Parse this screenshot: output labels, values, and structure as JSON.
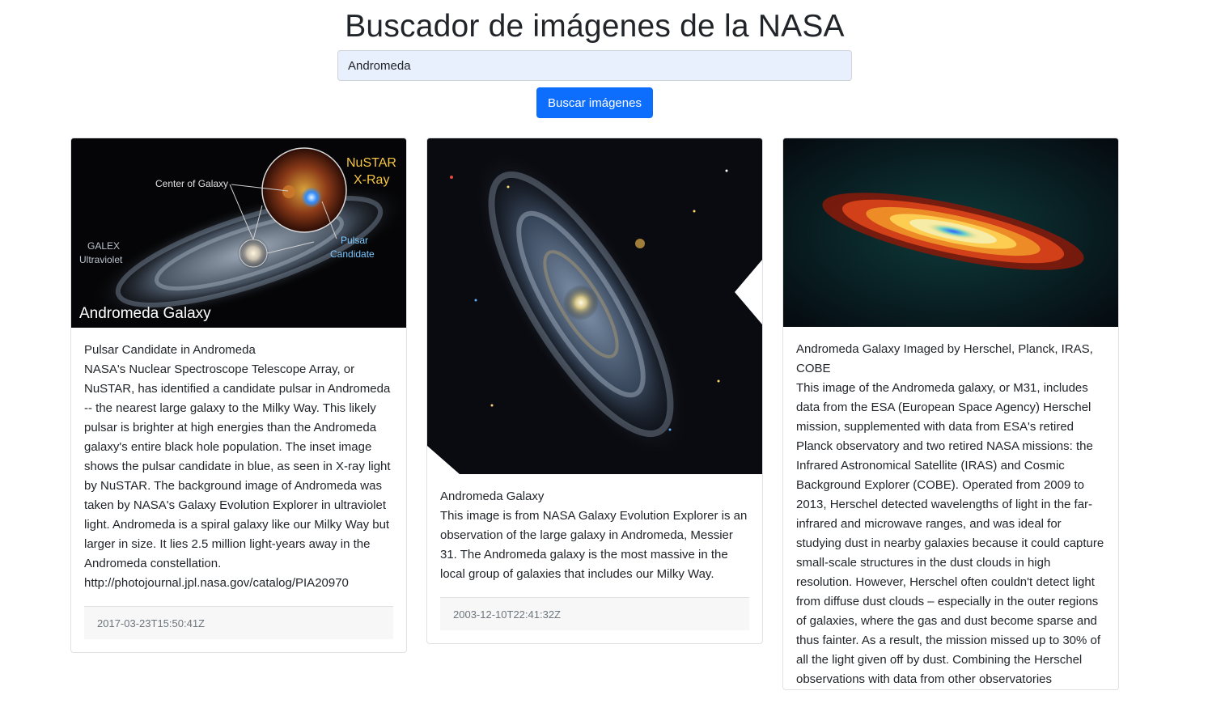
{
  "page": {
    "title": "Buscador de imágenes de la NASA"
  },
  "search": {
    "value": "Andromeda",
    "button_label": "Buscar imágenes"
  },
  "cards": [
    {
      "image_labels": {
        "main": "Andromeda Galaxy",
        "instrument_1": "NuSTAR",
        "instrument_2": "X-Ray",
        "center": "Center of Galaxy",
        "galex_1": "GALEX",
        "galex_2": "Ultraviolet",
        "pulsar_1": "Pulsar",
        "pulsar_2": "Candidate"
      },
      "title": "Pulsar Candidate in Andromeda",
      "description": "NASA's Nuclear Spectroscope Telescope Array, or NuSTAR, has identified a candidate pulsar in Andromeda -- the nearest large galaxy to the Milky Way. This likely pulsar is brighter at high energies than the Andromeda galaxy's entire black hole population. The inset image shows the pulsar candidate in blue, as seen in X-ray light by NuSTAR. The background image of Andromeda was taken by NASA's Galaxy Evolution Explorer in ultraviolet light. Andromeda is a spiral galaxy like our Milky Way but larger in size. It lies 2.5 million light-years away in the Andromeda constellation. http://photojournal.jpl.nasa.gov/catalog/PIA20970",
      "date": "2017-03-23T15:50:41Z"
    },
    {
      "title": "Andromeda Galaxy",
      "description": "This image is from NASA Galaxy Evolution Explorer is an observation of the large galaxy in Andromeda, Messier 31. The Andromeda galaxy is the most massive in the local group of galaxies that includes our Milky Way.",
      "date": "2003-12-10T22:41:32Z"
    },
    {
      "title": "Andromeda Galaxy Imaged by Herschel, Planck, IRAS, COBE",
      "description": "This image of the Andromeda galaxy, or M31, includes data from the ESA (European Space Agency) Herschel mission, supplemented with data from ESA's retired Planck observatory and two retired NASA missions: the Infrared Astronomical Satellite (IRAS) and Cosmic Background Explorer (COBE). Operated from 2009 to 2013, Herschel detected wavelengths of light in the far-infrared and microwave ranges, and was ideal for studying dust in nearby galaxies because it could capture small-scale structures in the dust clouds in high resolution. However, Herschel often couldn't detect light from diffuse dust clouds – especially in the outer regions of galaxies, where the gas and dust become sparse and thus fainter. As a result, the mission missed up to 30% of all the light given off by dust. Combining the Herschel observations with data from other observatories",
      "date": ""
    }
  ],
  "colors": {
    "primary": "#0d6efd",
    "input_bg": "#e8f0fe",
    "footer_bg": "#f7f7f7",
    "border": "#dfe1e4",
    "muted": "#6c757d"
  }
}
